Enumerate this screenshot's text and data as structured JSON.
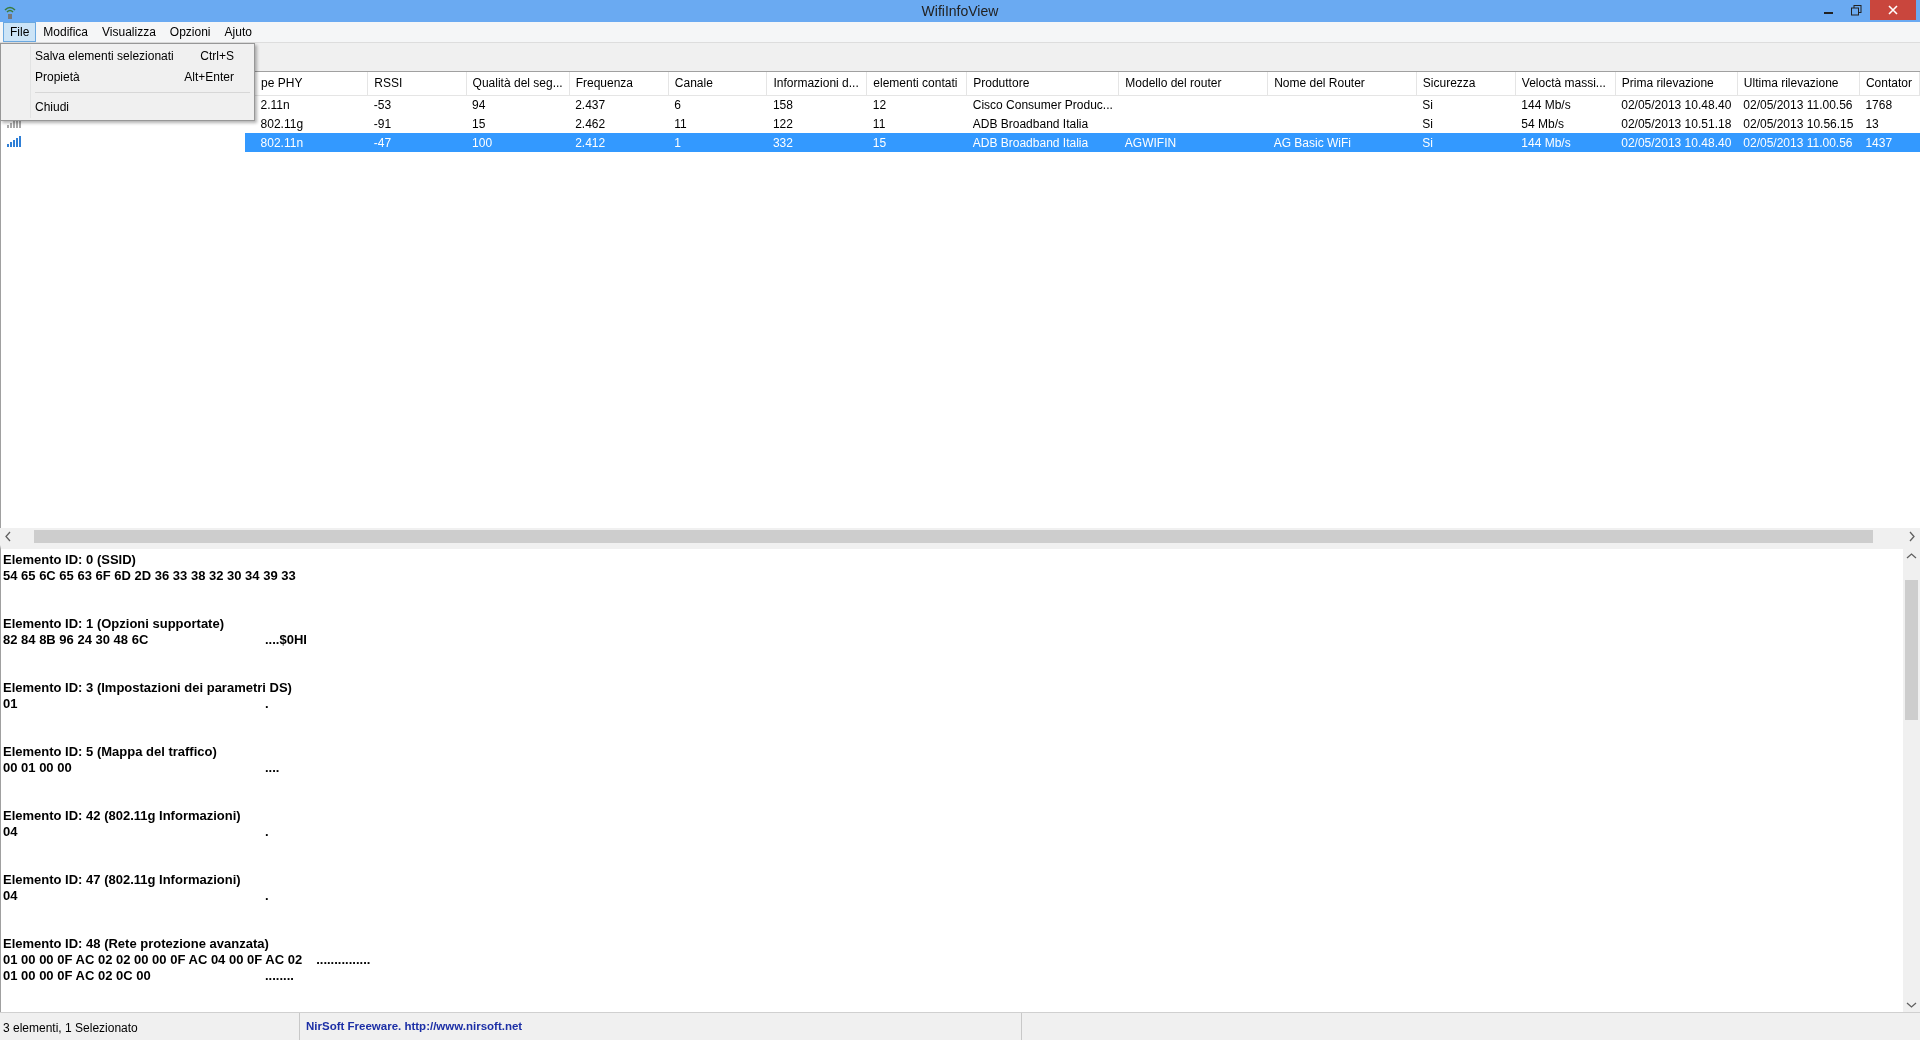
{
  "window": {
    "title": "WifiInfoView"
  },
  "menu_bar": [
    {
      "label": "File",
      "selected": true
    },
    {
      "label": "Modifica",
      "selected": false
    },
    {
      "label": "Visualizza",
      "selected": false
    },
    {
      "label": "Opzioni",
      "selected": false
    },
    {
      "label": "Ajuto",
      "selected": false
    }
  ],
  "file_menu": [
    {
      "kind": "item",
      "label": "Salva elementi selezionati",
      "shortcut": "Ctrl+S"
    },
    {
      "kind": "item",
      "label": "Propietà",
      "shortcut": "Alt+Enter"
    },
    {
      "kind": "separator"
    },
    {
      "kind": "item",
      "label": "Chiudi"
    }
  ],
  "table": {
    "columns": [
      "pe PHY",
      "RSSI",
      "Qualità del seg...",
      "Frequenza",
      "Canale",
      "Informazioni d...",
      "elementi contati",
      "Produttore",
      "Modello del router",
      "Nome del Router",
      "Sicurezza",
      "Veloctà massi...",
      "Prima rilevazione",
      "Ultima rilevazione",
      "Contator"
    ],
    "rows": [
      {
        "selected": false,
        "cells": [
          "2.11n",
          "-53",
          "94",
          "2.437",
          "6",
          "158",
          "12",
          "Cisco Consumer Produc...",
          "",
          "",
          "Si",
          "144 Mb/s",
          "02/05/2013 10.48.40",
          "02/05/2013 11.00.56",
          "1768"
        ]
      },
      {
        "selected": false,
        "kind": "weak",
        "cells": [
          "802.11g",
          "-91",
          "15",
          "2.462",
          "11",
          "122",
          "11",
          "ADB Broadband Italia",
          "",
          "",
          "Si",
          "54 Mb/s",
          "02/05/2013 10.51.18",
          "02/05/2013 10.56.15",
          "13"
        ]
      },
      {
        "selected": true,
        "kind": "strong",
        "cells": [
          "802.11n",
          "-47",
          "100",
          "2.412",
          "1",
          "332",
          "15",
          "ADB Broadband Italia",
          "AGWIFIN",
          "AG Basic WiFi",
          "Si",
          "144 Mb/s",
          "02/05/2013 10.48.40",
          "02/05/2013 11.00.56",
          "1437"
        ]
      }
    ]
  },
  "details": [
    {
      "heading": "Elemento ID: 0  (SSID)",
      "lines": [
        {
          "hex": "54 65 6C 65 63 6F 6D 2D 36 33 38 32 30 34 39 33"
        }
      ]
    },
    {
      "heading": "Elemento ID: 1  (Opzioni supportate)",
      "lines": [
        {
          "hex": "82 84 8B 96 24 30 48 6C",
          "ascii": "....$0HI"
        }
      ]
    },
    {
      "heading": "Elemento ID: 3  (Impostazioni dei parametri DS)",
      "lines": [
        {
          "hex": "01",
          "ascii": "."
        }
      ]
    },
    {
      "heading": "Elemento ID: 5  (Mappa del traffico)",
      "lines": [
        {
          "hex": "00 01 00 00",
          "ascii": "...."
        }
      ]
    },
    {
      "heading": "Elemento ID: 42  (802.11g Informazioni)",
      "lines": [
        {
          "hex": "04",
          "ascii": "."
        }
      ]
    },
    {
      "heading": "Elemento ID: 47  (802.11g Informazioni)",
      "lines": [
        {
          "hex": "04",
          "ascii": "."
        }
      ]
    },
    {
      "heading": "Elemento ID: 48  (Rete protezione avanzata)",
      "lines": [
        {
          "hex": "01 00 00 0F AC 02 02 00 00 0F AC 04 00 0F AC 02",
          "ascii": "..............."
        },
        {
          "hex": "01 00 00 0F AC 02 0C 00",
          "ascii": "........"
        }
      ]
    }
  ],
  "status_bar": {
    "count": "3 elementi, 1 Selezionato",
    "credit": "NirSoft Freeware.  http://www.nirsoft.net"
  }
}
